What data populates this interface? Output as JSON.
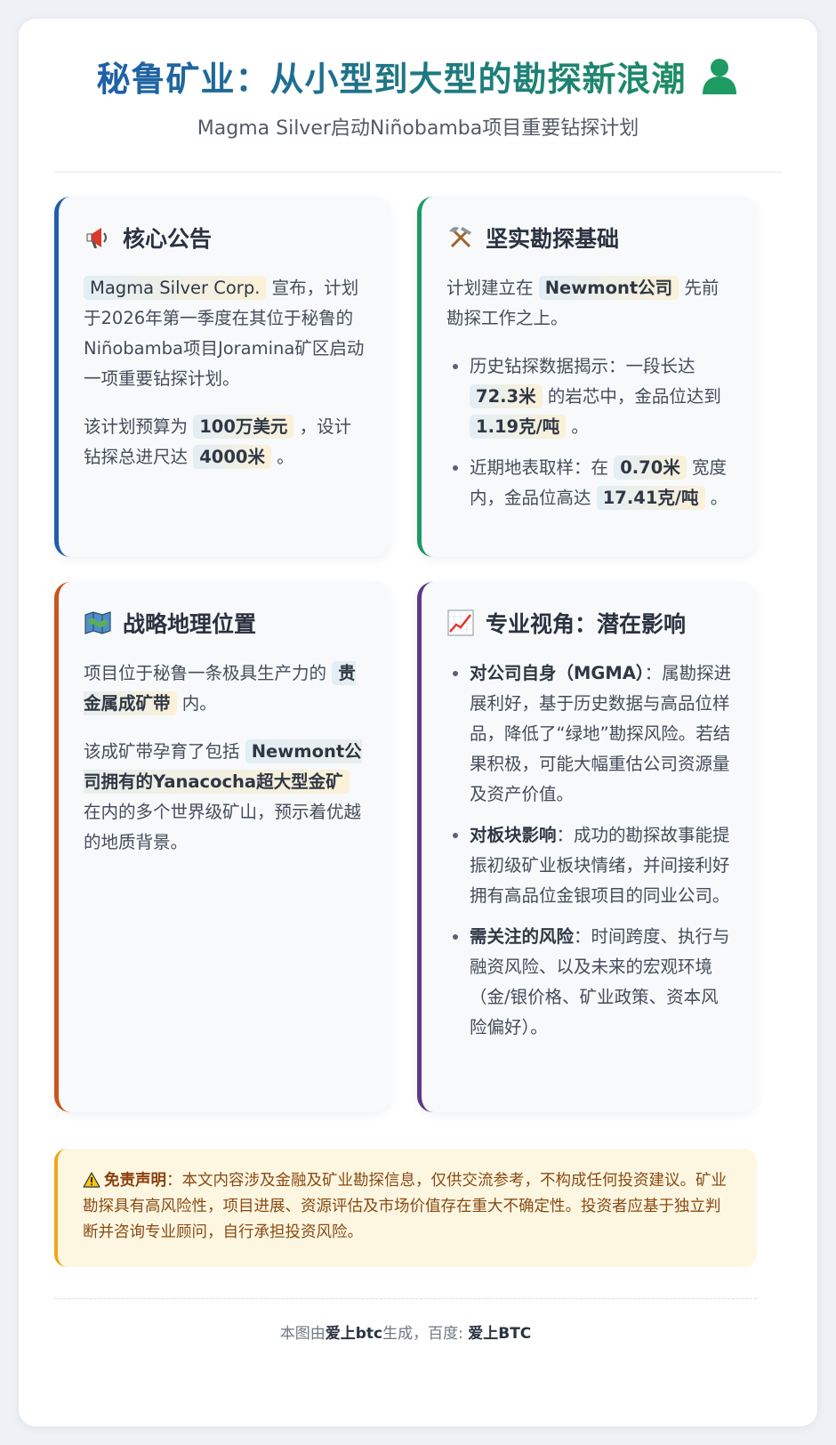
{
  "header": {
    "title": "秘鲁矿业：从小型到大型的勘探新浪潮",
    "title_icon": "person-icon",
    "subtitle": "Magma Silver启动Niñobamba项目重要钻探计划"
  },
  "colors": {
    "title_gradient": [
      "#1f5fa8",
      "#1e8d63"
    ],
    "card_announcement": "#1f5fa8",
    "card_foundation": "#1e9a63",
    "card_location": "#c8561d",
    "card_perspective": "#5b3a87",
    "disclaimer_accent": "#f0a51a"
  },
  "cards": {
    "announcement": {
      "icon": "megaphone-icon",
      "title": "核心公告",
      "p1_hl": "Magma Silver Corp.",
      "p1_text": " 宣布，计划于2026年第一季度在其位于秘鲁的Niñobamba项目Joramina矿区启动一项重要钻探计划。",
      "p2_a": "该计划预算为 ",
      "p2_hl1": "100万美元",
      "p2_b": " ，设计钻探总进尺达 ",
      "p2_hl2": "4000米",
      "p2_c": " 。"
    },
    "foundation": {
      "icon": "hammer-pick-icon",
      "title": "坚实勘探基础",
      "intro_a": "计划建立在 ",
      "intro_hl": "Newmont公司",
      "intro_b": " 先前勘探工作之上。",
      "li1_a": "历史钻探数据揭示：一段长达 ",
      "li1_hl1": "72.3米",
      "li1_b": " 的岩芯中，金品位达到 ",
      "li1_hl2": "1.19克/吨",
      "li1_c": " 。",
      "li2_a": "近期地表取样：在 ",
      "li2_hl1": "0.70米",
      "li2_b": " 宽度内，金品位高达 ",
      "li2_hl2": "17.41克/吨",
      "li2_c": " 。"
    },
    "location": {
      "icon": "map-icon",
      "title": "战略地理位置",
      "p1_a": "项目位于秘鲁一条极具生产力的 ",
      "p1_hl": "贵金属成矿带",
      "p1_b": " 内。",
      "p2_a": "该成矿带孕育了包括 ",
      "p2_hl": "Newmont公司拥有的Yanacocha超大型金矿",
      "p2_b": " 在内的多个世界级矿山，预示着优越的地质背景。"
    },
    "perspective": {
      "icon": "chart-up-icon",
      "title": "专业视角：潜在影响",
      "li1_b": "对公司自身（MGMA）",
      "li1_t": "：属勘探进展利好，基于历史数据与高品位样品，降低了“绿地”勘探风险。若结果积极，可能大幅重估公司资源量及资产价值。",
      "li2_b": "对板块影响",
      "li2_t": "：成功的勘探故事能提振初级矿业板块情绪，并间接利好拥有高品位金银项目的同业公司。",
      "li3_b": "需关注的风险",
      "li3_t": "：时间跨度、执行与融资风险、以及未来的宏观环境（金/银价格、矿业政策、资本风险偏好）。"
    }
  },
  "disclaimer": {
    "icon": "warning-icon",
    "label": "免责声明",
    "text": "：本文内容涉及金融及矿业勘探信息，仅供交流参考，不构成任何投资建议。矿业勘探具有高风险性，项目进展、资源评估及市场价值存在重大不确定性。投资者应基于独立判断并咨询专业顾问，自行承担投资风险。"
  },
  "footer": {
    "a": "本图由",
    "b": "爱上btc",
    "c": "生成，百度: ",
    "d": "爱上BTC"
  }
}
